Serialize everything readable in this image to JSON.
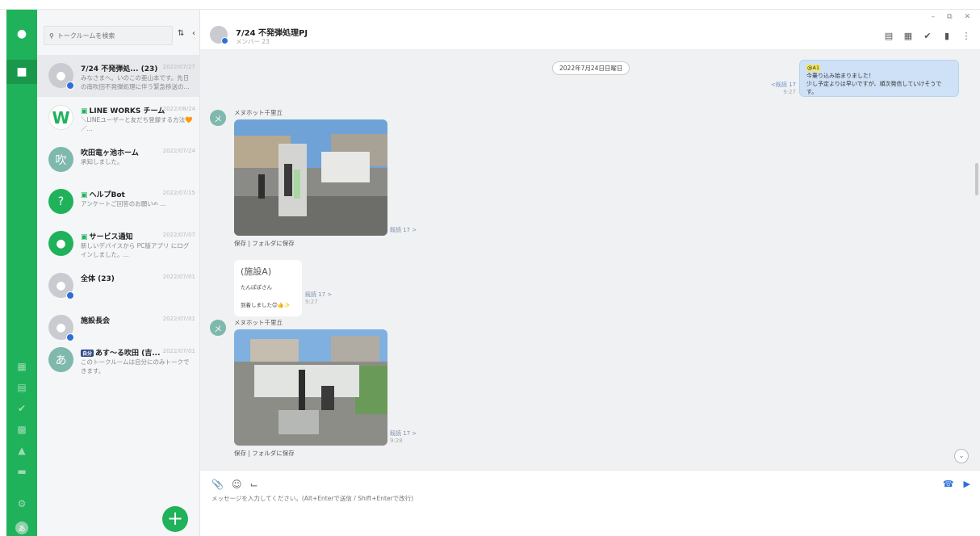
{
  "window": {
    "controls": "– ⧉ ✕"
  },
  "rail": {
    "me_initial": "あ"
  },
  "search": {
    "placeholder": "トークルームを検索"
  },
  "rooms": [
    {
      "name": "7/24 不発弾処... (23)",
      "date": "2022/07/27",
      "preview": "みなさまへ。いのこの亜山本です。先日の南吹田不発弾処理に伴う緊急移送の..."
    },
    {
      "name": "LINE WORKS チーム",
      "date": "2022/08/24",
      "preview": "＼LINEユーザーと友だち登録する方法🧡／..."
    },
    {
      "name": "吹田竜ヶ池ホーム",
      "date": "2022/07/24",
      "preview": "承知しました。",
      "initial": "吹"
    },
    {
      "name": "ヘルプBot",
      "date": "2022/07/15",
      "preview": "アンケートご回答のお願い✍ ..."
    },
    {
      "name": "サービス通知",
      "date": "2022/07/07",
      "preview": "新しいデバイスから PC版アプリ にログインしました。..."
    },
    {
      "name": "全体 (23)",
      "date": "2022/07/01",
      "preview": ""
    },
    {
      "name": "施設長会",
      "date": "2022/07/01",
      "preview": ""
    },
    {
      "name": "あす～る吹田 (吉...",
      "date": "2022/07/01",
      "preview": "このトークルームは自分にのみトークできます。",
      "initial": "あ",
      "tag": "自分"
    }
  ],
  "chat": {
    "title": "7/24 不発弾処理PJ",
    "members": "メンバー 23",
    "date_chip": "2022年7月24日日曜日",
    "my_msg": {
      "mention": "@A1",
      "line1": "今乗り込み始まりました！",
      "line2": "少し予定よりは早いですが、順次発信していけそうです。",
      "read": "<既読 17",
      "time": "9:27"
    },
    "sender": "メヌホット千里丘",
    "sender_initial": "メ",
    "photo1": {
      "read": "既読 17 >",
      "save": "保存 | フォルダに保存"
    },
    "text_msg": {
      "big": "(施設A)",
      "line1": "たんぽぽさん",
      "line2": "到着しました😊👍✨",
      "read": "既読 17 >",
      "time": "9:27"
    },
    "photo2": {
      "read": "既読 17 >",
      "time": "9:28",
      "save": "保存 | フォルダに保存"
    }
  },
  "composer": {
    "placeholder": "メッセージを入力してください。(Alt+Enterで送信 / Shift+Enterで改行)"
  },
  "colors": {
    "brand": "#1fb25a",
    "mine_bubble": "#cfe1f6",
    "badge": "#2d6fd8"
  }
}
